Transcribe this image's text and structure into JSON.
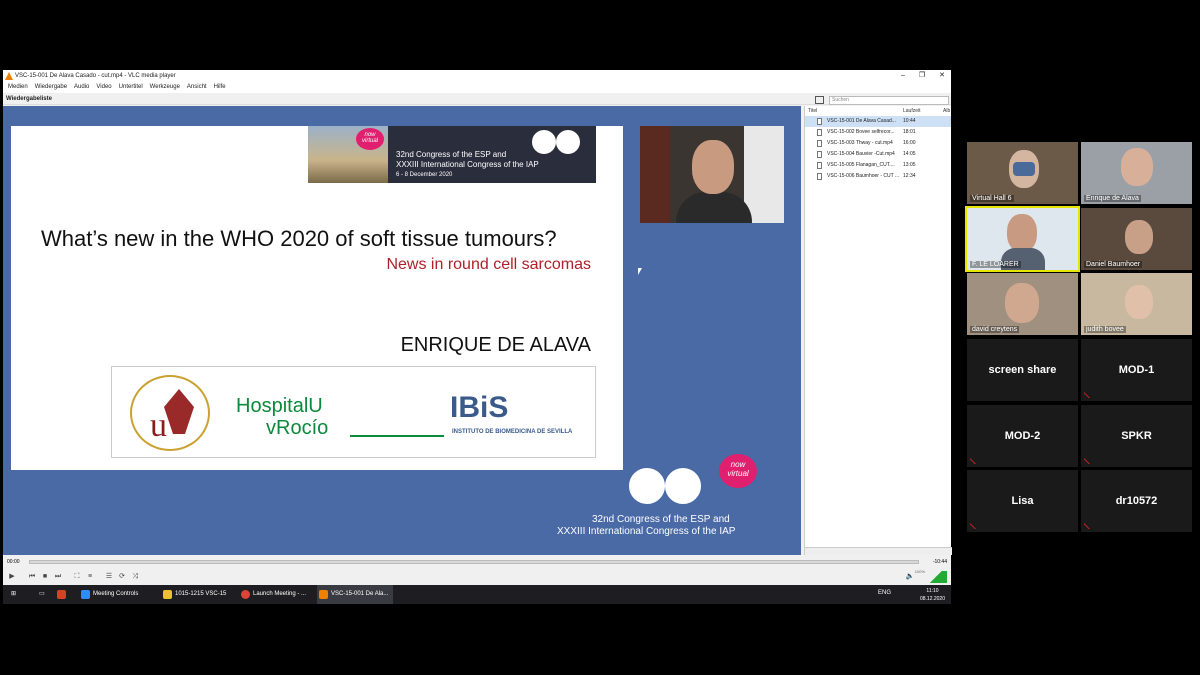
{
  "vlc": {
    "title": "VSC-15-001 De Alava Casado - cut.mp4 - VLC media player",
    "menu": [
      "Medien",
      "Wiedergabe",
      "Audio",
      "Video",
      "Untertitel",
      "Werkzeuge",
      "Ansicht",
      "Hilfe"
    ],
    "playlist_header": "Wiedergabeliste",
    "search_placeholder": "Suchen",
    "columns": {
      "title": "Titel",
      "duration": "Laufzeit",
      "album": "Alb"
    },
    "playlist": [
      {
        "title": "VSC-15-001 De Alava Casad...",
        "duration": "10:44",
        "selected": true
      },
      {
        "title": "VSC-15-002 Bovee selfrecor...",
        "duration": "18:01"
      },
      {
        "title": "VSC-15-003 Thway - cut.mp4",
        "duration": "16:00"
      },
      {
        "title": "VSC-15-004 Bauvier -Cut.mp4",
        "duration": "14:05"
      },
      {
        "title": "VSC-15-005 Flanagan_CUT....",
        "duration": "13:05"
      },
      {
        "title": "VSC-15-006 Baumhoer - CUT ...",
        "duration": "12:34"
      }
    ],
    "time_elapsed": "00:00",
    "time_remaining": "-10:44",
    "volume": "100%"
  },
  "slide": {
    "banner_line1": "32nd Congress of the ESP and",
    "banner_line2": "XXXIII International Congress of the IAP",
    "banner_dates": "6 - 8 December 2020",
    "now_virtual": "now virtual",
    "title": "What’s new in the WHO 2020 of soft tissue tumours?",
    "subtitle": "News in round cell sarcomas",
    "author": "ENRIQUE DE ALAVA",
    "logo_hospital_1": "HospitalU",
    "logo_hospital_2": "vRocío",
    "logo_ibis": "IBiS",
    "logo_ibis_sub": "INSTITUTO DE BIOMEDICINA DE SEVILLA",
    "logo_us_letter": "u",
    "bottom_line1": "32nd Congress of the ESP and",
    "bottom_line2": "XXXIII International Congress of the IAP"
  },
  "taskbar": {
    "items": [
      "Meeting Controls",
      "1015-1215 VSC-15",
      "Launch Meeting - ...",
      "VSC-15-001 De Ala..."
    ],
    "lang": "ENG",
    "time": "11:10",
    "date": "08.12.2020"
  },
  "gallery": {
    "participants": [
      {
        "name": "Virtual Hall 6"
      },
      {
        "name": "Enrique de Alava"
      },
      {
        "name": "F. LE LOARER"
      },
      {
        "name": "Daniel Baumhoer"
      },
      {
        "name": "david creytens"
      },
      {
        "name": "judith bovee"
      }
    ],
    "audio_only": [
      "screen share",
      "MOD-1",
      "MOD-2",
      "SPKR",
      "Lisa",
      "dr10572"
    ]
  },
  "colors": {
    "slide_bg": "#4a6aa6",
    "accent_red": "#b0202a",
    "now_virtual": "#e0206e",
    "hospital_green": "#0a8a3a"
  }
}
